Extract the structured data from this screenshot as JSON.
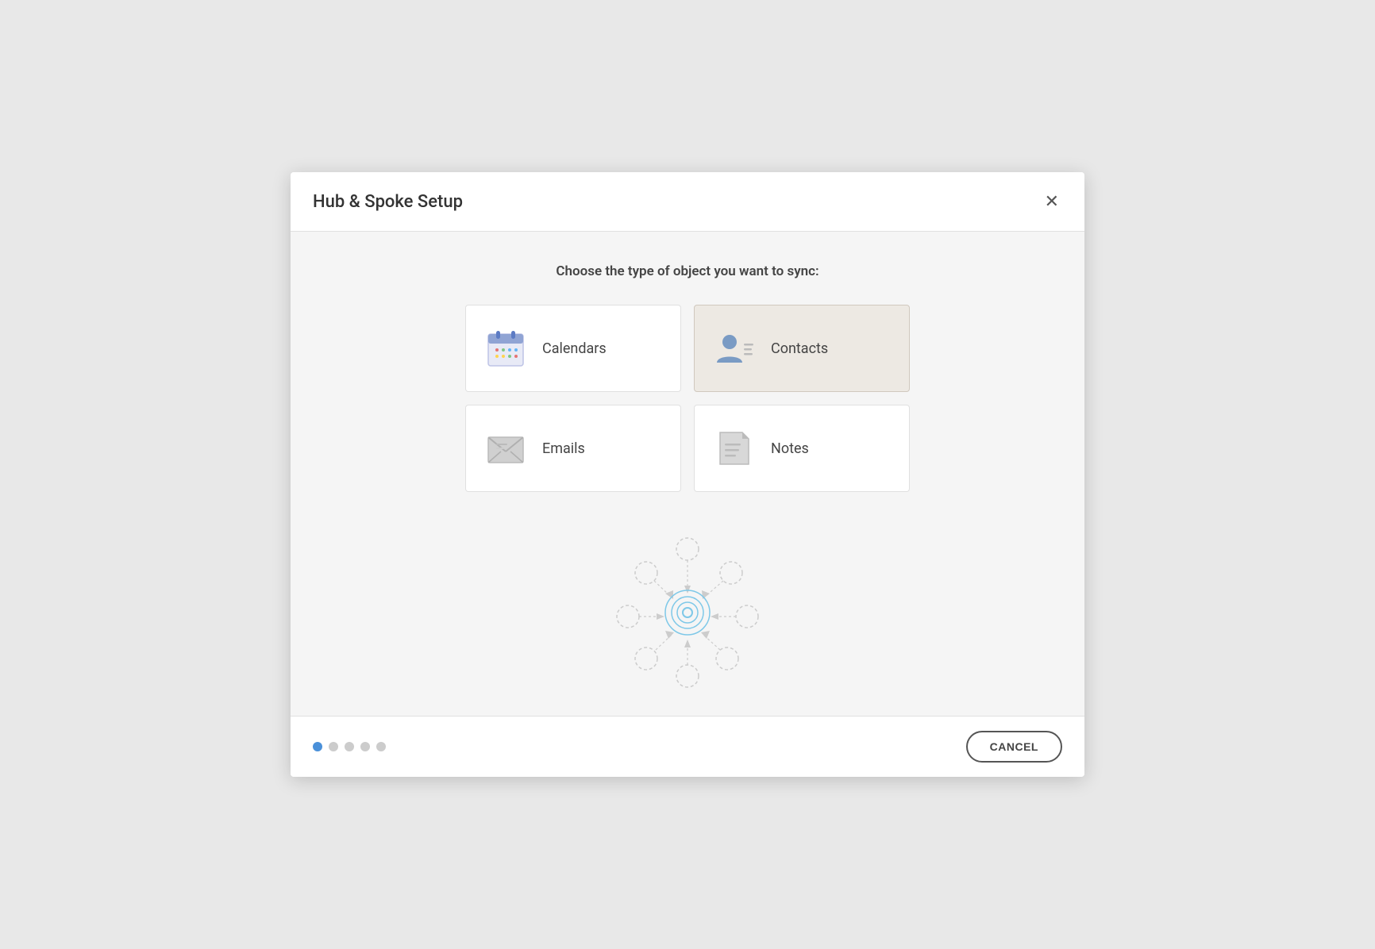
{
  "dialog": {
    "title": "Hub & Spoke Setup",
    "close_label": "✕",
    "prompt": "Choose the type of object you want to sync:",
    "options": [
      {
        "id": "calendars",
        "label": "Calendars",
        "selected": false
      },
      {
        "id": "contacts",
        "label": "Contacts",
        "selected": true
      },
      {
        "id": "emails",
        "label": "Emails",
        "selected": false
      },
      {
        "id": "notes",
        "label": "Notes",
        "selected": false
      }
    ]
  },
  "footer": {
    "cancel_label": "CANCEL",
    "dots": [
      {
        "active": true
      },
      {
        "active": false
      },
      {
        "active": false
      },
      {
        "active": false
      },
      {
        "active": false
      }
    ]
  }
}
